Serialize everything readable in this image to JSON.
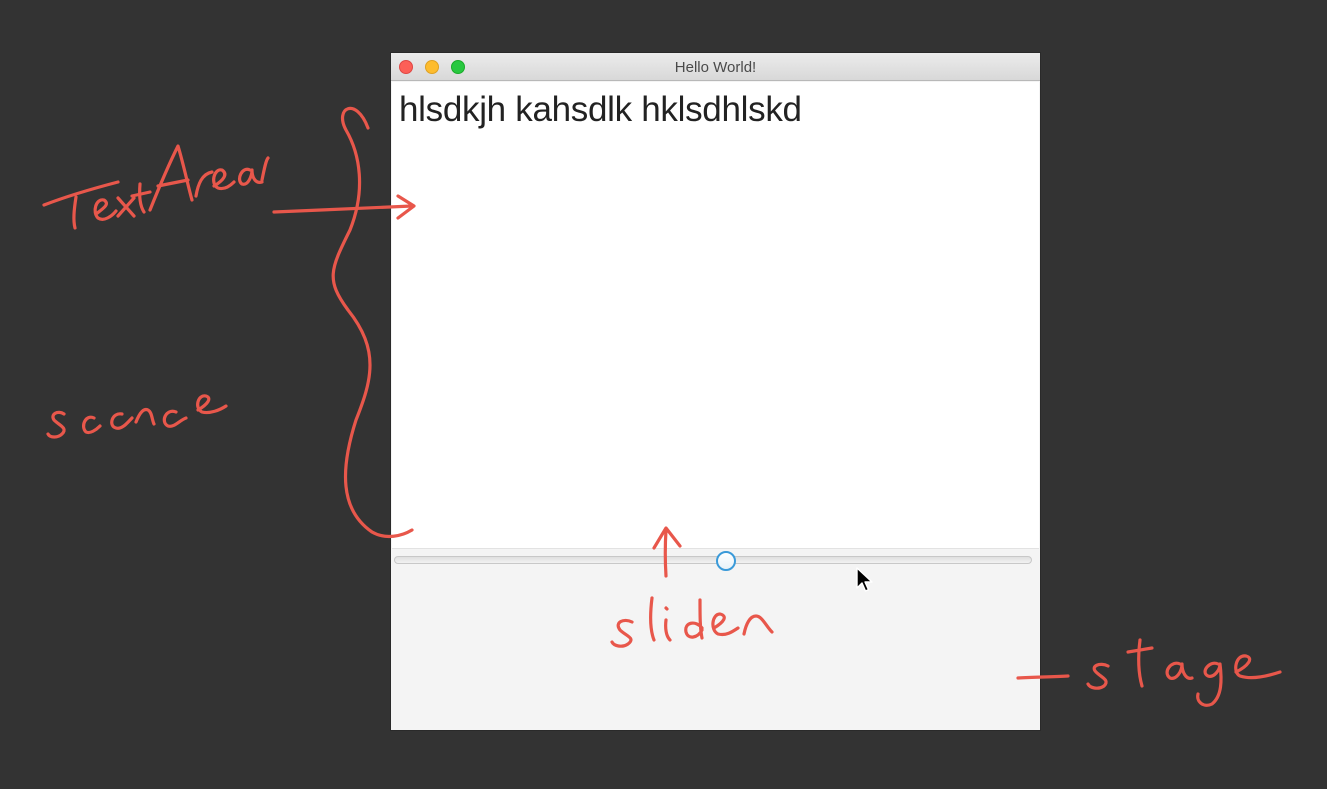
{
  "window": {
    "title": "Hello World!",
    "controls": [
      "close",
      "minimize",
      "maximize"
    ]
  },
  "textarea": {
    "value": "hlsdkjh kahsdlk hklsdhlskd"
  },
  "slider": {
    "value_fraction": 0.52
  },
  "annotations": {
    "textarea_label": "TextArea",
    "scene_label": "scence",
    "slider_label": "slider",
    "stage_label": "stage",
    "ink_color": "#e8574b"
  }
}
